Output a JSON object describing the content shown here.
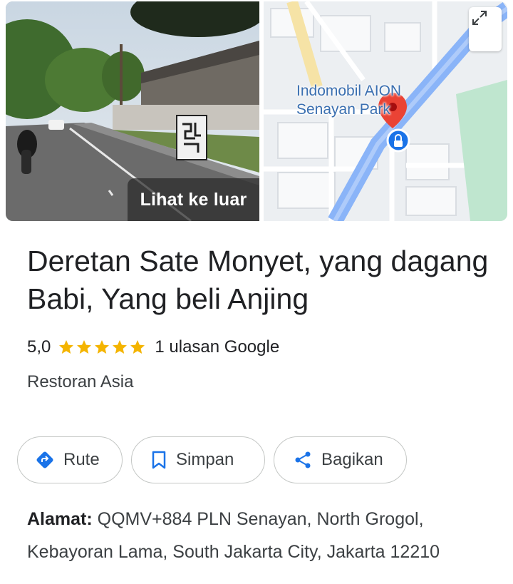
{
  "media": {
    "look_out_label": "Lihat ke luar",
    "map_label_line1": "Indomobil AION",
    "map_label_line2": "Senayan Park"
  },
  "place": {
    "title": "Deretan Sate Monyet, yang dagang Babi, Yang beli Anjing",
    "rating": "5,0",
    "stars": 5,
    "reviews_label": "1 ulasan Google",
    "category": "Restoran Asia"
  },
  "actions": {
    "route_label": "Rute",
    "save_label": "Simpan",
    "share_label": "Bagikan"
  },
  "address": {
    "label": "Alamat:",
    "value": "QQMV+884 PLN Senayan, North Grogol, Kebayoran Lama, South Jakarta City, Jakarta 12210"
  },
  "colors": {
    "star": "#f4b400",
    "map_road": "#8ab4f8",
    "pin": "#ea4335",
    "route_icon": "#1a73e8"
  }
}
